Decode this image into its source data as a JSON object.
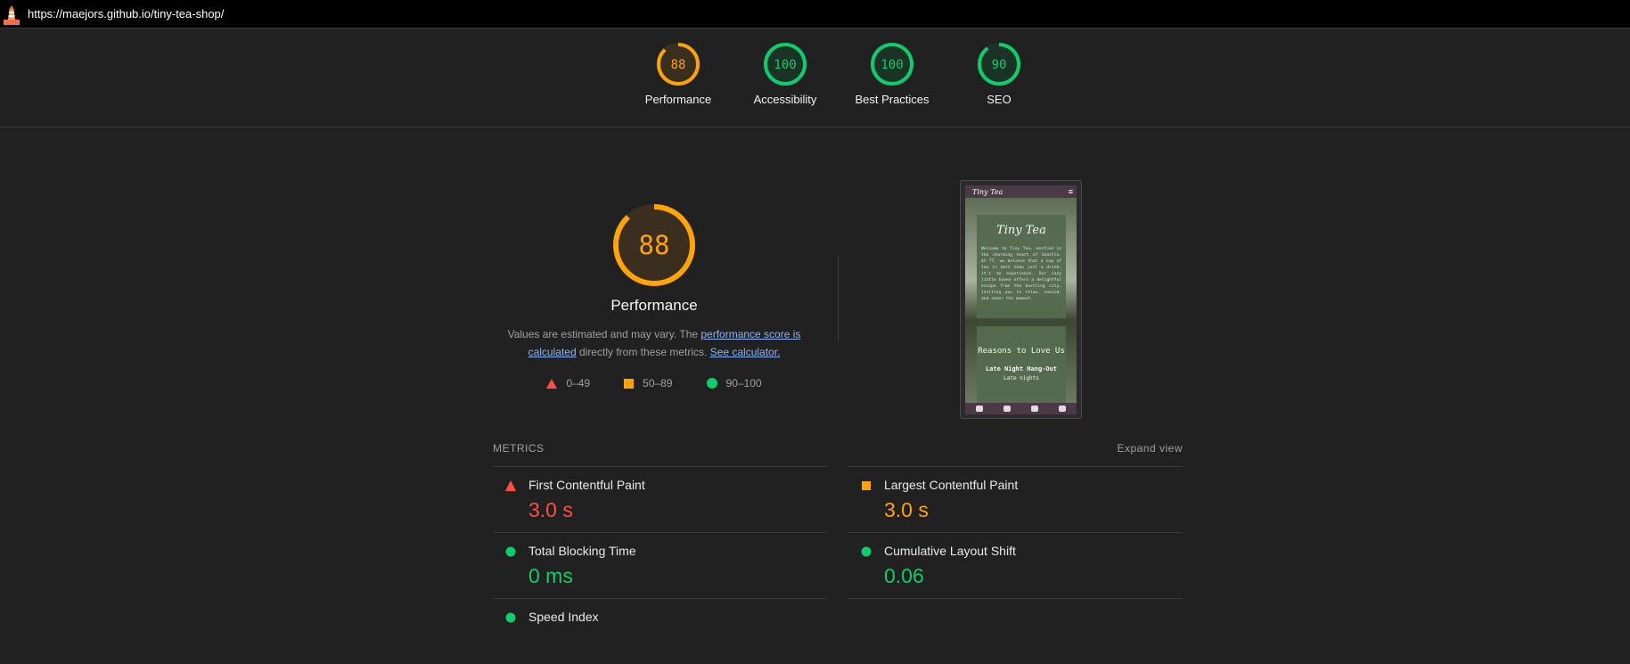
{
  "browser": {
    "url": "https://maejors.github.io/tiny-tea-shop/"
  },
  "colors": {
    "orange": "#ffa400",
    "green": "#0cce6b",
    "red": "#ff4e42"
  },
  "gauges": [
    {
      "label": "Performance",
      "score": "88",
      "value": 0.88,
      "rating": "average"
    },
    {
      "label": "Accessibility",
      "score": "100",
      "value": 1.0,
      "rating": "pass"
    },
    {
      "label": "Best Practices",
      "score": "100",
      "value": 1.0,
      "rating": "pass"
    },
    {
      "label": "SEO",
      "score": "90",
      "value": 0.9,
      "rating": "pass"
    }
  ],
  "performance": {
    "score": "88",
    "title": "Performance",
    "desc_prefix": "Values are estimated and may vary. The ",
    "desc_link1": "performance score is calculated",
    "desc_middle": " directly from these metrics. ",
    "desc_link2": "See calculator.",
    "legend": [
      "0–49",
      "50–89",
      "90–100"
    ]
  },
  "preview": {
    "brand": "Tiny Tea",
    "hero_title": "Tiny Tea",
    "hero_text": "Welcome to Tiny Tea, nestled in the charming heart of Seattle. At TT, we believe that a cup of tea is more than just a drink-it's an experience. Our cozy little haven offers a delightful escape from the bustling city, inviting you to relax, unwind, and savor the moment.",
    "section_title": "Reasons to Love Us",
    "item_title": "Late Night Hang-Out",
    "item_text": "Late nights"
  },
  "metrics": {
    "heading": "METRICS",
    "expand": "Expand view",
    "items": [
      {
        "name": "First Contentful Paint",
        "value": "3.0 s",
        "rating": "fail"
      },
      {
        "name": "Largest Contentful Paint",
        "value": "3.0 s",
        "rating": "average"
      },
      {
        "name": "Total Blocking Time",
        "value": "0 ms",
        "rating": "pass"
      },
      {
        "name": "Cumulative Layout Shift",
        "value": "0.06",
        "rating": "pass"
      },
      {
        "name": "Speed Index",
        "value": "",
        "rating": "pass"
      }
    ]
  }
}
